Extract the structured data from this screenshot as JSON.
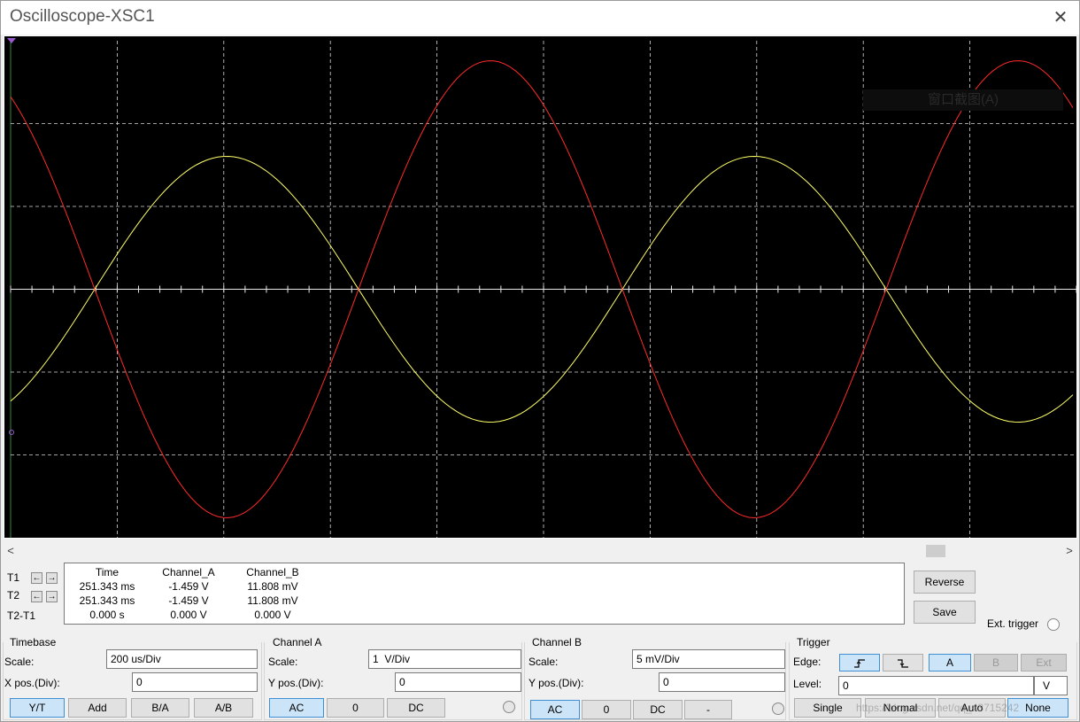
{
  "window": {
    "title": "Oscilloscope-XSC1",
    "close_glyph": "✕"
  },
  "screen": {
    "overlay_text": "窗口截图(A)"
  },
  "scrollbar": {
    "left_glyph": "<",
    "right_glyph": ">"
  },
  "cursors": {
    "t1": "T1",
    "t2": "T2",
    "t2t1": "T2-T1",
    "left_icon": "arrow-left-icon",
    "right_icon": "arrow-right-icon"
  },
  "measurements": {
    "headers": [
      "Time",
      "Channel_A",
      "Channel_B"
    ],
    "rows": [
      [
        "251.343 ms",
        "-1.459 V",
        "11.808 mV"
      ],
      [
        "251.343 ms",
        "-1.459 V",
        "11.808 mV"
      ],
      [
        "0.000 s",
        "0.000 V",
        "0.000 V"
      ]
    ]
  },
  "side": {
    "reverse": "Reverse",
    "save": "Save",
    "ext_trigger": "Ext. trigger"
  },
  "timebase": {
    "title": "Timebase",
    "scale_label": "Scale:",
    "scale": "200 us/Div",
    "xpos_label": "X pos.(Div):",
    "xpos": "0",
    "buttons": [
      "Y/T",
      "Add",
      "B/A",
      "A/B"
    ],
    "selected": "Y/T"
  },
  "channel_a": {
    "title": "Channel A",
    "scale_label": "Scale:",
    "scale": "1  V/Div",
    "ypos_label": "Y pos.(Div):",
    "ypos": "0",
    "buttons": [
      "AC",
      "0",
      "DC"
    ],
    "selected": "AC"
  },
  "channel_b": {
    "title": "Channel B",
    "scale_label": "Scale:",
    "scale": "5 mV/Div",
    "ypos_label": "Y pos.(Div):",
    "ypos": "0",
    "buttons": [
      "AC",
      "0",
      "DC",
      "-"
    ],
    "selected": "AC"
  },
  "trigger": {
    "title": "Trigger",
    "edge_label": "Edge:",
    "level_label": "Level:",
    "level": "0",
    "level_unit": "V",
    "edge_buttons": [
      "rising-edge-icon",
      "falling-edge-icon"
    ],
    "source_buttons": [
      "A",
      "B",
      "Ext"
    ],
    "source_selected": "A",
    "mode_buttons": [
      "Single",
      "Normal",
      "Auto",
      "None"
    ],
    "mode_selected": "None"
  },
  "watermark": "https://blog.csdn.net/qq_43715242",
  "colors": {
    "channel_a": "#ffff66",
    "channel_b": "#ff2a2a",
    "grid": "#d8d8d8",
    "screen_bg": "#000000",
    "selected": "#cce4f7"
  }
}
